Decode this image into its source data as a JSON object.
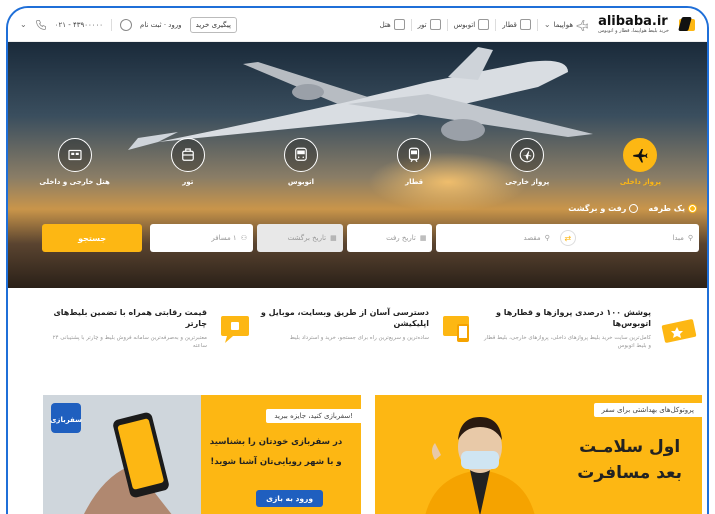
{
  "header": {
    "logo_name": "alibaba.ir",
    "logo_sub": "خرید بلیط هواپیما، قطار و اتوبوس",
    "nav": [
      {
        "label": "هواپیما",
        "icon": "airplane-icon",
        "has_chevron": true
      },
      {
        "label": "قطار",
        "icon": "train-icon"
      },
      {
        "label": "اتوبوس",
        "icon": "bus-icon"
      },
      {
        "label": "تور",
        "icon": "tour-icon"
      },
      {
        "label": "هتل",
        "icon": "hotel-icon"
      }
    ],
    "track_button": "پیگیری خرید",
    "login": "ورود · ثبت نام",
    "phone": "۰۲۱ - ۴۳۹۰۰۰۰۰"
  },
  "services": [
    {
      "label": "پرواز داخلی",
      "icon": "airplane-icon",
      "active": true
    },
    {
      "label": "پرواز خارجی",
      "icon": "globe-plane-icon"
    },
    {
      "label": "قطار",
      "icon": "train-icon"
    },
    {
      "label": "اتوبوس",
      "icon": "bus-icon"
    },
    {
      "label": "تور",
      "icon": "luggage-icon"
    },
    {
      "label": "هتل خارجی و داخلی",
      "icon": "hotel-icon"
    }
  ],
  "trip_type": {
    "one_way": "یک طرفه",
    "round_trip": "رفت و برگشت",
    "selected": "one_way"
  },
  "search": {
    "origin": "مبدا",
    "destination": "مقصد",
    "depart_date": "تاریخ رفت",
    "return_date": "تاریخ برگشت",
    "passengers": "۱ مسافر",
    "button": "جستجو"
  },
  "features": [
    {
      "title": "پوشش ۱۰۰ درصدی پروازها و قطارها و اتوبوس‌ها",
      "desc": "کامل‌ترین سایت خرید بلیط پروازهای داخلی، پروازهای خارجی، بلیط قطار و بلیط اتوبوس",
      "icon": "ticket-icon"
    },
    {
      "title": "دسترسی آسان از طریق وبسایت، موبایل و اپلیکیشن",
      "desc": "ساده‌ترین و سریع‌ترین راه برای جستجو، خرید و استرداد بلیط",
      "icon": "devices-icon"
    },
    {
      "title": "قیمت رقابتی همراه با تضمین بلیط‌های چارتر",
      "desc": "معتبرترین و به‌صرفه‌ترین سامانه فروش بلیط و چارتر با پشتیبانی ۲۴ ساعته",
      "icon": "chat-badge-icon"
    }
  ],
  "banner_health": {
    "tag": "پروتوکل‌های بهداشتی برای سفر",
    "line1": "اول سلامـت",
    "line2": "بعد مسافرت"
  },
  "banner_game": {
    "tag": "سفربازی کنید، جایزه ببرید!",
    "line1": "در سفربازی خودتان را بشناسید",
    "line2": "و با شهر رویایی‌تان آشنا شوید!",
    "button": "ورود به بازی",
    "logo_text": "سفربازی"
  },
  "colors": {
    "accent": "#fdb713",
    "brand_blue": "#1f5fbf"
  }
}
